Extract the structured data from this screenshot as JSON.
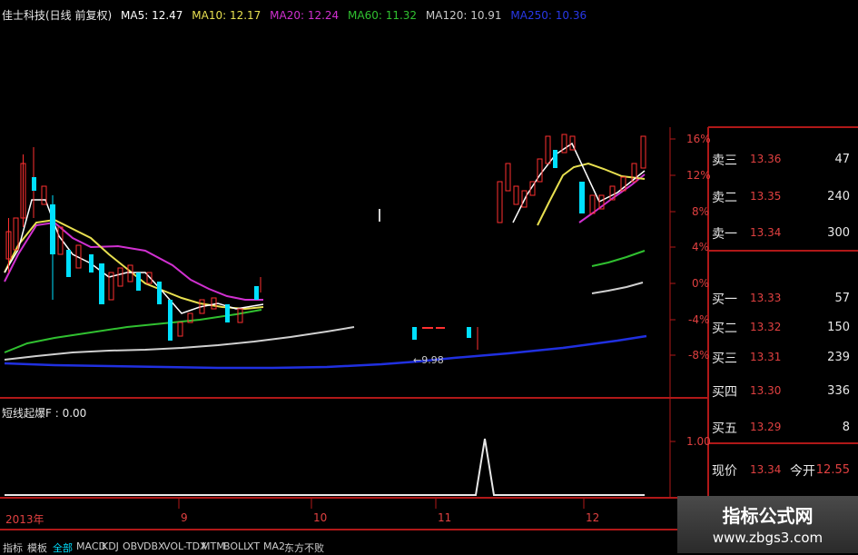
{
  "header": {
    "title": "佳士科技(日线 前复权)",
    "ma5": "MA5: 12.47",
    "ma10": "MA10: 12.17",
    "ma20": "MA20: 12.24",
    "ma60": "MA60: 11.32",
    "ma120": "MA120: 10.91",
    "ma250": "MA250: 10.36"
  },
  "colors": {
    "ma5": "#ffffff",
    "ma10": "#e8e050",
    "ma20": "#d030d0",
    "ma60": "#30c030",
    "ma120": "#c8c8c8",
    "ma250": "#2030e0",
    "up": "#ff3030",
    "down": "#00e0ff",
    "border": "#b01818"
  },
  "y_axis_pct": [
    "16%",
    "12%",
    "8%",
    "4%",
    "0%",
    "-4%",
    "-8%"
  ],
  "indicator": {
    "label": "短线起爆F : 0.00",
    "axis": "1.00"
  },
  "low_marker": "←9.98",
  "x_axis": [
    "2013年",
    "9",
    "10",
    "11",
    "12"
  ],
  "quotes": {
    "sell": [
      {
        "name": "卖三",
        "price": "13.36",
        "vol": "47"
      },
      {
        "name": "卖二",
        "price": "13.35",
        "vol": "240"
      },
      {
        "name": "卖一",
        "price": "13.34",
        "vol": "300"
      }
    ],
    "buy": [
      {
        "name": "买一",
        "price": "13.33",
        "vol": "57"
      },
      {
        "name": "买二",
        "price": "13.32",
        "vol": "150"
      },
      {
        "name": "买三",
        "price": "13.31",
        "vol": "239"
      },
      {
        "name": "买四",
        "price": "13.30",
        "vol": "336"
      },
      {
        "name": "买五",
        "price": "13.29",
        "vol": "8"
      }
    ],
    "current_label": "现价",
    "current_price": "13.34",
    "open_label": "今开",
    "open_price": "12.55"
  },
  "tabs": [
    "指标",
    "模板",
    "全部",
    "MACD",
    "KDJ",
    "OBV",
    "DBX",
    "VOL-TDX",
    "MTM",
    "BOLL",
    "XT",
    "MA2",
    "东方不败"
  ],
  "active_tab": "全部",
  "watermark": {
    "title": "指标公式网",
    "url": "www.zbgs3.com"
  }
}
